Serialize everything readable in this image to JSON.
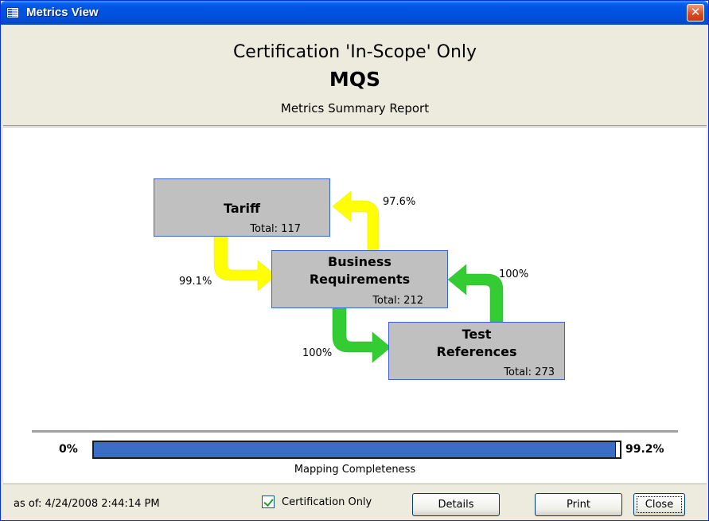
{
  "window": {
    "title": "Metrics View",
    "close_glyph": "✕"
  },
  "header": {
    "line1": "Certification 'In-Scope' Only",
    "line2": "MQS",
    "line3": "Metrics Summary Report"
  },
  "nodes": {
    "tariff": {
      "title": "Tariff",
      "total": "Total: 117"
    },
    "business": {
      "title_line1": "Business",
      "title_line2": "Requirements",
      "total": "Total: 212"
    },
    "test": {
      "title_line1": "Test",
      "title_line2": "References",
      "total": "Total: 273"
    }
  },
  "arrows": {
    "business_to_tariff": {
      "pct": "97.6%",
      "color": "#ffff00"
    },
    "tariff_to_business": {
      "pct": "99.1%",
      "color": "#ffff00"
    },
    "test_to_business": {
      "pct": "100%",
      "color": "#33cc33"
    },
    "business_to_test": {
      "pct": "100%",
      "color": "#33cc33"
    }
  },
  "progress": {
    "min_label": "0%",
    "max_label": "99.2%",
    "value_percent": 99.2,
    "caption": "Mapping Completeness",
    "fill_color": "#3b6dc7"
  },
  "footer": {
    "as_of": "as of:  4/24/2008 2:44:14 PM",
    "checkbox_label": "Certification Only",
    "checkbox_checked": true,
    "details_label": "Details",
    "print_label": "Print",
    "close_label": "Close"
  }
}
